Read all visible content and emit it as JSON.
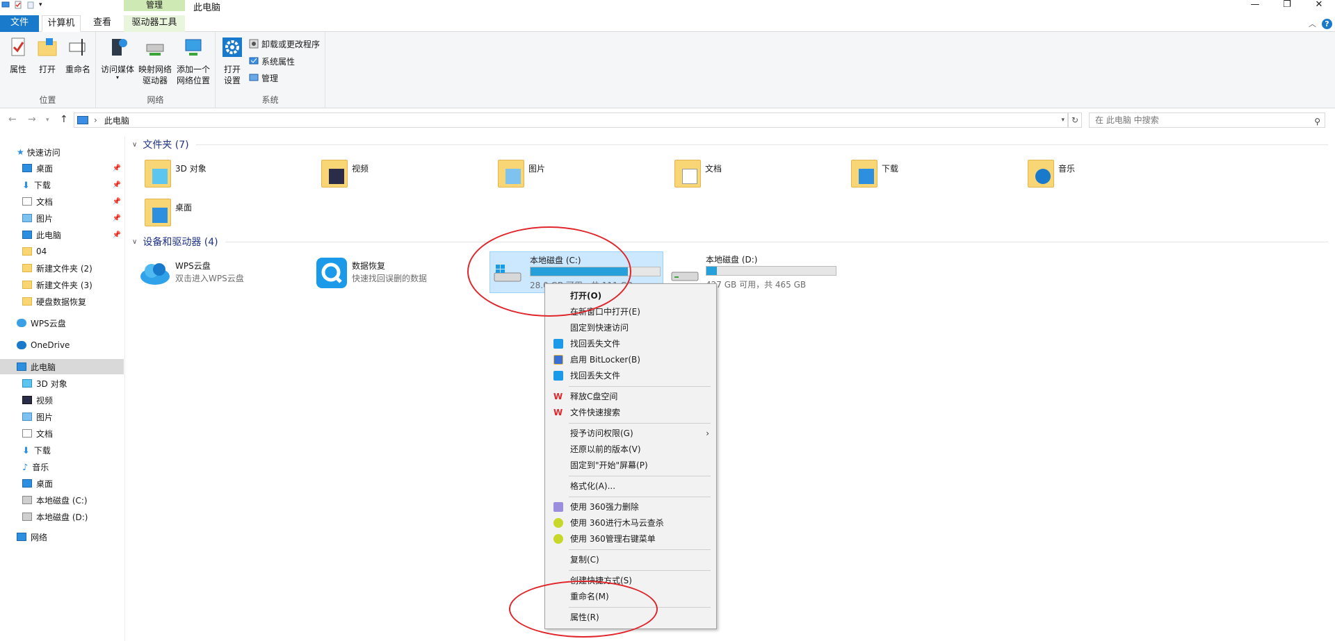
{
  "window": {
    "title": "此电脑",
    "manage_tab": "管理",
    "controls": [
      "—",
      "❐",
      "✕"
    ]
  },
  "ribbon_tabs": {
    "file": "文件",
    "computer": "计算机",
    "view": "查看",
    "drive_tools": "驱动器工具"
  },
  "ribbon": {
    "location_group": {
      "label": "位置",
      "properties": "属性",
      "open": "打开",
      "rename": "重命名"
    },
    "network_group": {
      "label": "网络",
      "access_media": "访问媒体",
      "map_drive_line1": "映射网络",
      "map_drive_line2": "驱动器",
      "add_location_line1": "添加一个",
      "add_location_line2": "网络位置"
    },
    "system_group": {
      "label": "系统",
      "open_settings_line1": "打开",
      "open_settings_line2": "设置",
      "uninstall": "卸载或更改程序",
      "system_props": "系统属性",
      "manage": "管理"
    }
  },
  "address": {
    "crumb": "此电脑",
    "search_placeholder": "在 此电脑 中搜索"
  },
  "sidebar": {
    "quick_access": "快速访问",
    "quick_items": [
      {
        "label": "桌面",
        "pinned": true
      },
      {
        "label": "下载",
        "pinned": true
      },
      {
        "label": "文档",
        "pinned": true
      },
      {
        "label": "图片",
        "pinned": true
      },
      {
        "label": "此电脑",
        "pinned": true
      },
      {
        "label": "04",
        "pinned": false
      },
      {
        "label": "新建文件夹 (2)",
        "pinned": false
      },
      {
        "label": "新建文件夹 (3)",
        "pinned": false
      },
      {
        "label": "硬盘数据恢复",
        "pinned": false
      }
    ],
    "wps": "WPS云盘",
    "onedrive": "OneDrive",
    "this_pc": "此电脑",
    "pc_items": [
      "3D 对象",
      "视频",
      "图片",
      "文档",
      "下载",
      "音乐",
      "桌面",
      "本地磁盘 (C:)",
      "本地磁盘 (D:)"
    ],
    "network": "网络"
  },
  "content": {
    "folders_header": "文件夹 (7)",
    "folders": [
      "3D 对象",
      "视频",
      "图片",
      "文档",
      "下载",
      "音乐",
      "桌面"
    ],
    "devices_header": "设备和驱动器 (4)",
    "wps": {
      "name": "WPS云盘",
      "sub": "双击进入WPS云盘"
    },
    "recovery": {
      "name": "数据恢复",
      "sub": "快速找回误删的数据"
    },
    "drive_c": {
      "name": "本地磁盘 (C:)",
      "sub": "28.0 GB 可用，共 111 GB",
      "used_fraction": 0.75
    },
    "drive_d": {
      "name": "本地磁盘 (D:)",
      "sub": "427 GB 可用，共 465 GB",
      "used_fraction": 0.08
    }
  },
  "context_menu": {
    "open": "打开(O)",
    "open_new_window": "在新窗口中打开(E)",
    "pin_quick": "固定到快速访问",
    "recover_1": "找回丢失文件",
    "bitlocker": "启用 BitLocker(B)",
    "recover_2": "找回丢失文件",
    "free_c": "释放C盘空间",
    "quick_search": "文件快速搜索",
    "grant_access": "授予访问权限(G)",
    "restore": "还原以前的版本(V)",
    "pin_start": "固定到\"开始\"屏幕(P)",
    "format": "格式化(A)...",
    "del_360": "使用 360强力删除",
    "scan_360": "使用 360进行木马云查杀",
    "menu_360": "使用 360管理右键菜单",
    "copy": "复制(C)",
    "shortcut": "创建快捷方式(S)",
    "rename": "重命名(M)",
    "properties": "属性(R)"
  },
  "colors": {
    "accent": "#1979ca",
    "drive_fill": "#26a0da",
    "annotation": "#e0262b",
    "selection": "#cce8ff"
  }
}
